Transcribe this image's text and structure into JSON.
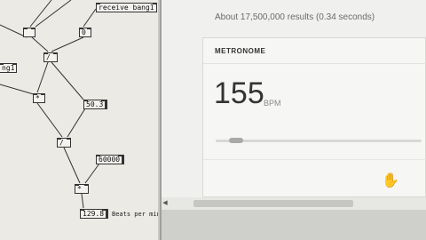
{
  "patch": {
    "objects": {
      "receive": "receive bang1",
      "msg_left": "",
      "msg_right": "0",
      "edge_label": "ng1",
      "middle_obj": "/",
      "mult_obj": "*",
      "number_mid": "50.3",
      "div_obj": "/",
      "number_60000": "60000",
      "mul_obj": "*",
      "bpm_number": "129.8"
    },
    "comment": "Beats per minute"
  },
  "browser": {
    "results_stats": "About 17,500,000 results (0.34 seconds)",
    "metronome": {
      "title": "METRONOME",
      "bpm_value": "155",
      "bpm_unit": "BPM",
      "slider_fraction": 0.07
    },
    "cursor_icon": "hand-pointer-icon",
    "scroll_left_icon": "scroll-left-arrow-icon"
  }
}
